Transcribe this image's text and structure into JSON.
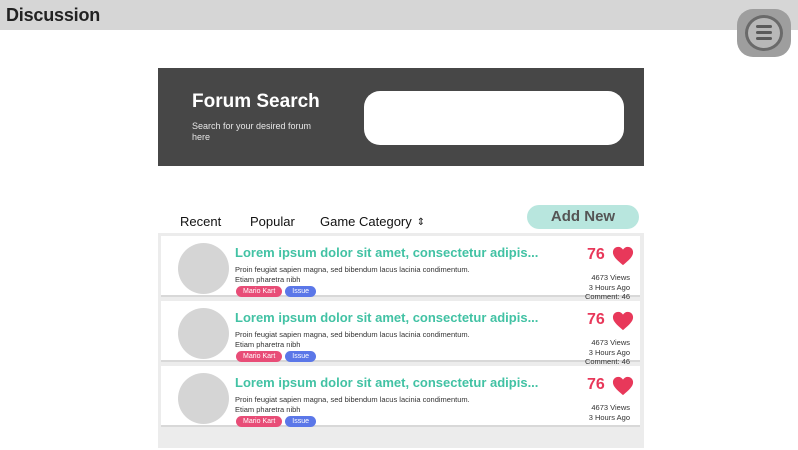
{
  "header": {
    "title": "Discussion",
    "menu_icon": "hamburger-menu-icon"
  },
  "search": {
    "title": "Forum Search",
    "subtitle": "Search for your desired forum here",
    "placeholder": "",
    "value": ""
  },
  "tabs": [
    {
      "label": "Recent",
      "active": true
    },
    {
      "label": "Popular",
      "active": false
    },
    {
      "label": "Game Category",
      "icon": "sort-updown-icon",
      "active": false
    }
  ],
  "add_new_label": "Add New",
  "colors": {
    "title_text": "#42c2a4",
    "likes": "#e8385a",
    "tag_game": "#e84d77",
    "tag_issue": "#5b77e8",
    "add_button": "#b8e6de",
    "search_panel": "#474747",
    "tab_underline": "#5fb8cf"
  },
  "posts": [
    {
      "title": "Lorem ipsum dolor sit amet, consectetur adipis...",
      "body": "Proin feugiat sapien magna, sed bibendum lacus lacinia condimentum. Etiam pharetra nibh",
      "tags": [
        "Mario Kart",
        "Issue"
      ],
      "likes": "76",
      "views": "4673 Views",
      "time": "3 Hours Ago",
      "comments": "Comment:  46"
    },
    {
      "title": "Lorem ipsum dolor sit amet, consectetur adipis...",
      "body": "Proin feugiat sapien magna, sed bibendum lacus lacinia condimentum. Etiam pharetra nibh",
      "tags": [
        "Mario Kart",
        "Issue"
      ],
      "likes": "76",
      "views": "4673 Views",
      "time": "3 Hours Ago",
      "comments": "Comment:  46"
    },
    {
      "title": "Lorem ipsum dolor sit amet, consectetur adipis...",
      "body": "Proin feugiat sapien magna, sed bibendum lacus lacinia condimentum. Etiam pharetra nibh",
      "tags": [
        "Mario Kart",
        "Issue"
      ],
      "likes": "76",
      "views": "4673 Views",
      "time": "3 Hours Ago",
      "comments": ""
    }
  ]
}
